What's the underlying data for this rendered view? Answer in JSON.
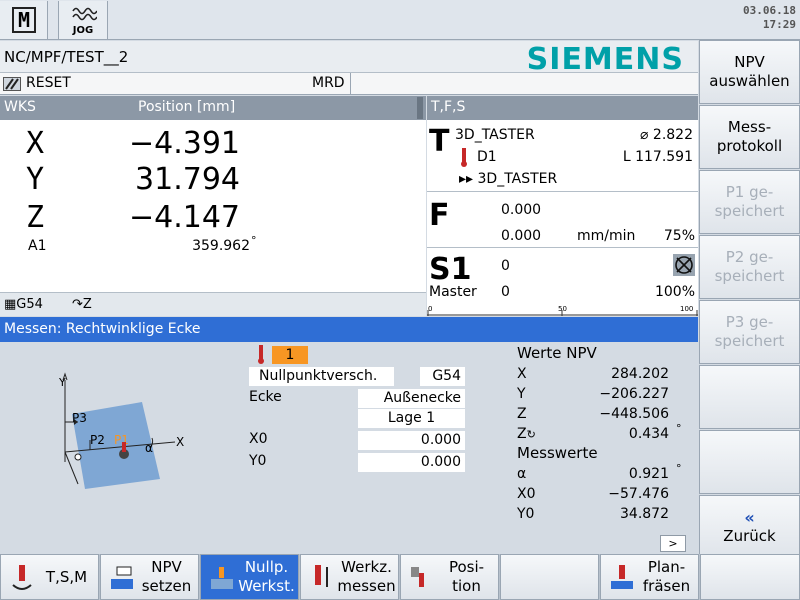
{
  "header": {
    "mode_m_label": "M",
    "mode_jog_label": "JOG",
    "date": "03.06.18",
    "time": "17:29",
    "program_path": "NC/MPF/TEST__2",
    "brand": "SIEMENS",
    "status": "RESET",
    "status_mrd": "MRD"
  },
  "position": {
    "title_wcs": "WKS",
    "title_position": "Position [mm]",
    "axes": [
      {
        "name": "X",
        "value": "−4.391"
      },
      {
        "name": "Y",
        "value": "31.794"
      },
      {
        "name": "Z",
        "value": "−4.147"
      }
    ],
    "a1_name": "A1",
    "a1_value": "359.962",
    "a1_unit": "°",
    "work_offset": "G54",
    "plane": "Z"
  },
  "tfs": {
    "title": "T,F,S",
    "t_letter": "T",
    "tool_name": "3D_TASTER",
    "tool_diameter": "⌀ 2.822",
    "d_label": "D1",
    "tool_length": "L 117.591",
    "next_tool": "3D_TASTER",
    "f_letter": "F",
    "f_value1": "0.000",
    "f_value2": "0.000",
    "f_unit": "mm/min",
    "f_override": "75%",
    "s_letter": "S1",
    "s_value": "0",
    "s_master_label": "Master",
    "s_master_value": "0",
    "s_override": "100%",
    "scale_0": "0",
    "scale_50": "50",
    "scale_100": "100"
  },
  "measure": {
    "title": "Messen: Rechtwinklige Ecke",
    "probe_number": "1",
    "offset_field": "Nullpunktversch.",
    "offset_value": "G54",
    "corner_label": "Ecke",
    "corner_value": "Außenecke",
    "position_value": "Lage 1",
    "x0_label": "X0",
    "x0_value": "0.000",
    "y0_label": "Y0",
    "y0_value": "0.000",
    "diagram": {
      "y_axis": "Y",
      "x_axis": "X",
      "p1": "P1",
      "p2": "P2",
      "p3": "P3",
      "alpha": "α"
    },
    "results_title": "Werte NPV",
    "results": [
      {
        "name": "X",
        "value": "284.202"
      },
      {
        "name": "Y",
        "value": "−206.227"
      },
      {
        "name": "Z",
        "value": "−448.506"
      },
      {
        "name": "Z",
        "value": "0.434"
      }
    ],
    "measured_title": "Messwerte",
    "measured": [
      {
        "name": "α",
        "value": "0.921"
      },
      {
        "name": "X0",
        "value": "−57.476"
      },
      {
        "name": "Y0",
        "value": "34.872"
      }
    ],
    "degree_symbol": "°",
    "nav_arrow": ">"
  },
  "vertical_softkeys": [
    {
      "line1": "NPV",
      "line2": "auswählen",
      "enabled": true
    },
    {
      "line1": "Mess-",
      "line2": "protokoll",
      "enabled": true
    },
    {
      "line1": "P1 ge-",
      "line2": "speichert",
      "enabled": false
    },
    {
      "line1": "P2 ge-",
      "line2": "speichert",
      "enabled": false
    },
    {
      "line1": "P3 ge-",
      "line2": "speichert",
      "enabled": false
    },
    {
      "line1": "",
      "line2": "",
      "enabled": true
    },
    {
      "line1": "",
      "line2": "",
      "enabled": true
    },
    {
      "line1": "«",
      "line2": "Zurück",
      "enabled": true
    }
  ],
  "horizontal_softkeys": [
    {
      "line1": "T,S,M",
      "line2": ""
    },
    {
      "line1": "NPV",
      "line2": "setzen"
    },
    {
      "line1": "Nullp.",
      "line2": "Werkst."
    },
    {
      "line1": "Werkz.",
      "line2": "messen"
    },
    {
      "line1": "Posi-",
      "line2": "tion"
    },
    {
      "line1": "",
      "line2": ""
    },
    {
      "line1": "Plan-",
      "line2": "fräsen"
    },
    {
      "line1": "",
      "line2": ""
    }
  ],
  "colors": {
    "accent_blue": "#2f6ed5",
    "siemens_teal": "#00a0a8",
    "probe_orange": "#f79623",
    "header_gray": "#8c98a6"
  }
}
